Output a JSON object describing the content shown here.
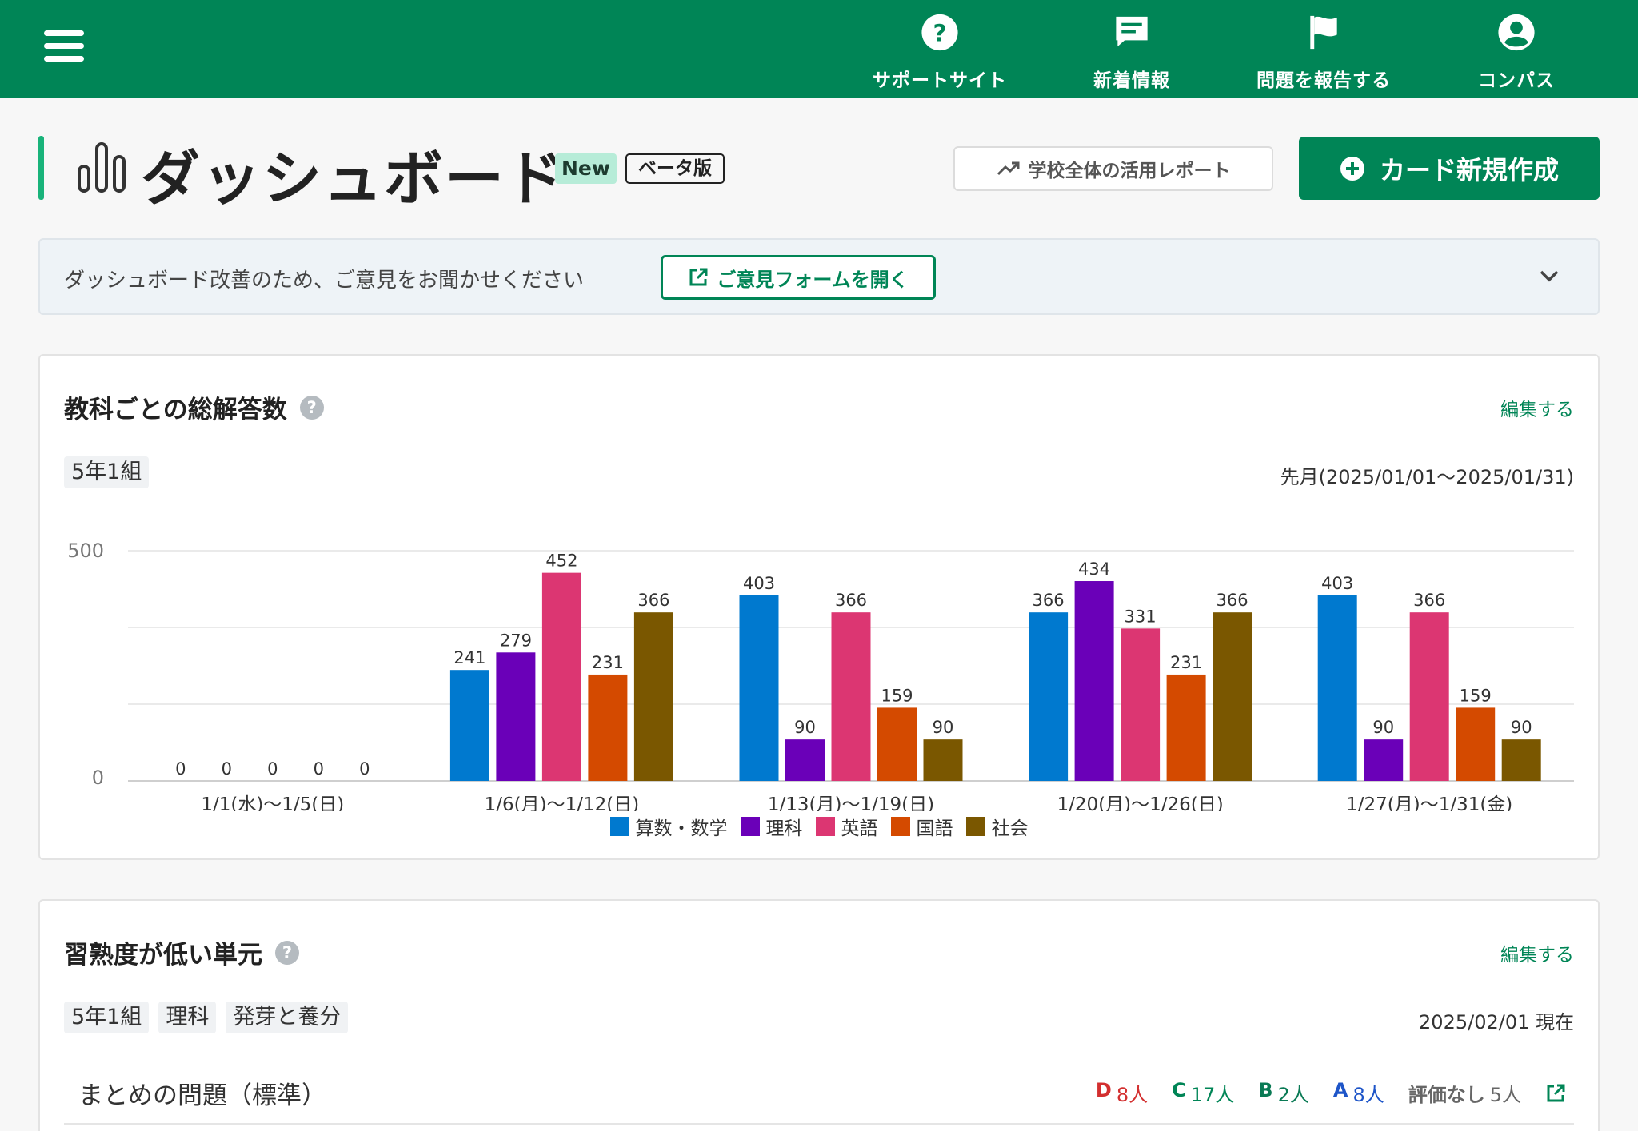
{
  "header": {
    "nav": [
      {
        "label": "サポートサイト",
        "icon": "help-circle-icon"
      },
      {
        "label": "新着情報",
        "icon": "message-icon"
      },
      {
        "label": "問題を報告する",
        "icon": "flag-icon"
      },
      {
        "label": "コンパス",
        "icon": "account-icon"
      }
    ]
  },
  "page": {
    "title": "ダッシュボード",
    "badge_new": "New",
    "badge_beta": "ベータ版",
    "report_button": "学校全体の活用レポート",
    "create_button": "カード新規作成"
  },
  "feedback": {
    "text": "ダッシュボード改善のため、ご意見をお聞かせください",
    "button": "ご意見フォームを開く"
  },
  "card1": {
    "title": "教科ごとの総解答数",
    "edit": "編集する",
    "tag": "5年1組",
    "period": "先月(2025/01/01〜2025/01/31)"
  },
  "chart_data": {
    "type": "bar",
    "categories": [
      "1/1(水)〜1/5(日)",
      "1/6(月)〜1/12(日)",
      "1/13(月)〜1/19(日)",
      "1/20(月)〜1/26(日)",
      "1/27(月)〜1/31(金)"
    ],
    "series": [
      {
        "name": "算数・数学",
        "color": "#0079cf",
        "values": [
          0,
          241,
          403,
          366,
          403
        ]
      },
      {
        "name": "理科",
        "color": "#6a00b8",
        "values": [
          0,
          279,
          90,
          434,
          90
        ]
      },
      {
        "name": "英語",
        "color": "#dc3672",
        "values": [
          0,
          452,
          366,
          331,
          366
        ]
      },
      {
        "name": "国語",
        "color": "#d44a00",
        "values": [
          0,
          231,
          159,
          231,
          159
        ]
      },
      {
        "name": "社会",
        "color": "#7a5700",
        "values": [
          0,
          366,
          90,
          366,
          90
        ]
      }
    ],
    "yticks": [
      "500",
      "0"
    ],
    "ylim": [
      0,
      500
    ],
    "grid": true,
    "legend": "bottom"
  },
  "card2": {
    "title": "習熟度が低い単元",
    "edit": "編集する",
    "tags": [
      "5年1組",
      "理科",
      "発芽と養分"
    ],
    "asof": "2025/02/01 現在",
    "row": {
      "title": "まとめの問題（標準）",
      "stats": [
        {
          "grade": "D",
          "count": "8人",
          "color": "#d32f2f"
        },
        {
          "grade": "C",
          "count": "17人",
          "color": "#008556"
        },
        {
          "grade": "B",
          "count": "2人",
          "color": "#0a7a55"
        },
        {
          "grade": "A",
          "count": "8人",
          "color": "#1e55c8"
        },
        {
          "grade": "評価なし",
          "count": "5人",
          "color": "#666666"
        }
      ]
    }
  }
}
